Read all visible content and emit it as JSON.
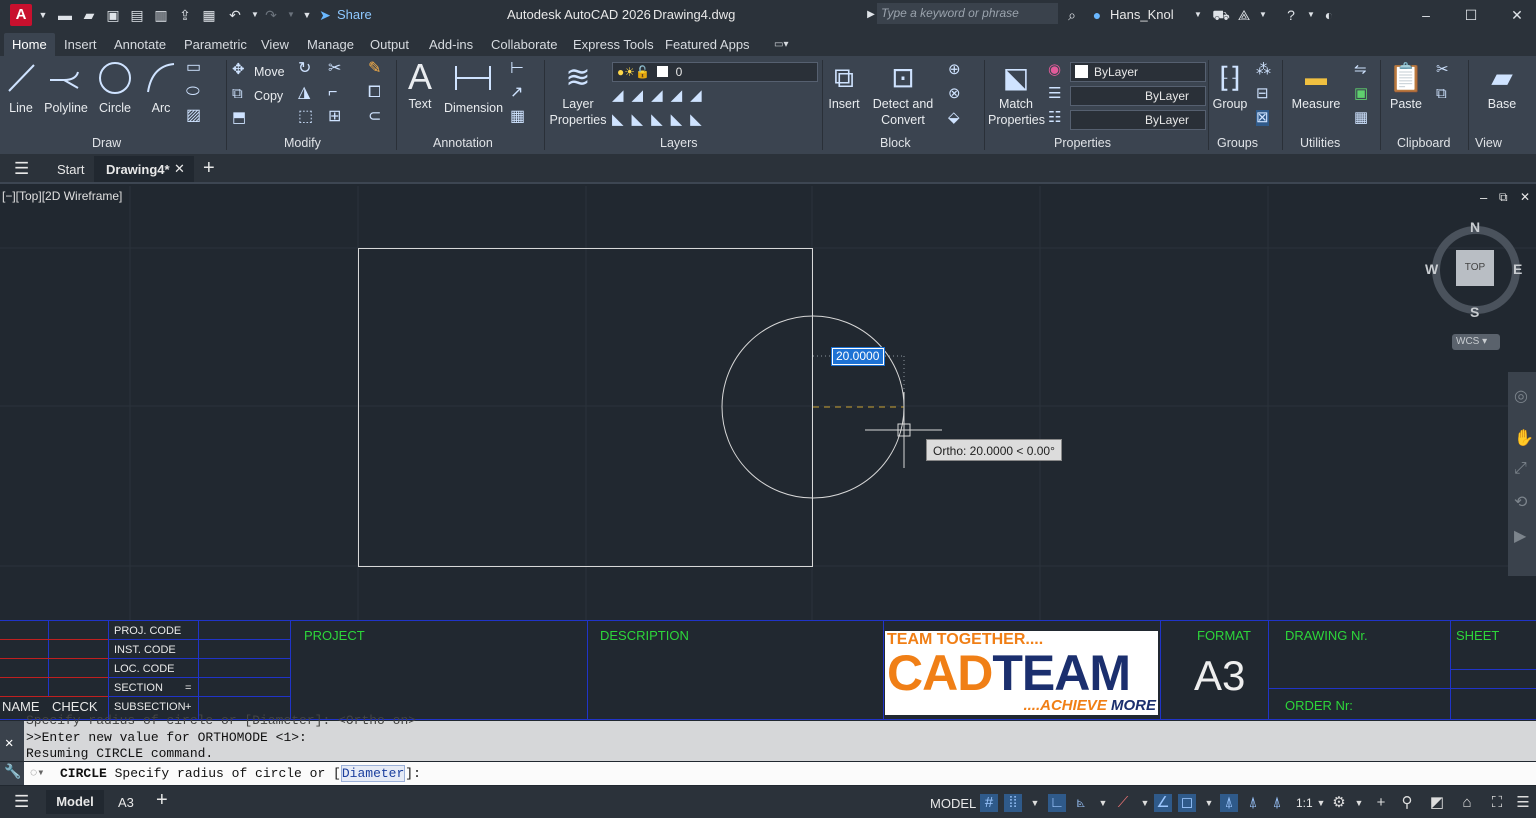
{
  "titlebar": {
    "app_logo": "A",
    "share_label": "Share",
    "app_title": "Autodesk AutoCAD 2026",
    "file_name": "Drawing4.dwg",
    "search_placeholder": "Type a keyword or phrase",
    "user_name": "Hans_Knol"
  },
  "ribbon_tabs": [
    "Home",
    "Insert",
    "Annotate",
    "Parametric",
    "View",
    "Manage",
    "Output",
    "Add-ins",
    "Collaborate",
    "Express Tools",
    "Featured Apps"
  ],
  "ribbon": {
    "draw": {
      "title": "Draw",
      "line": "Line",
      "polyline": "Polyline",
      "circle": "Circle",
      "arc": "Arc"
    },
    "modify": {
      "title": "Modify",
      "move": "Move",
      "copy": "Copy"
    },
    "annotation": {
      "title": "Annotation",
      "text": "Text",
      "dimension": "Dimension"
    },
    "layers": {
      "title": "Layers",
      "layer_properties_1": "Layer",
      "layer_properties_2": "Properties",
      "current_layer": "0"
    },
    "block": {
      "title": "Block",
      "insert": "Insert",
      "detect_1": "Detect and",
      "detect_2": "Convert"
    },
    "properties": {
      "title": "Properties",
      "match_1": "Match",
      "match_2": "Properties",
      "color": "ByLayer",
      "linetype": "ByLayer",
      "lineweight": "ByLayer"
    },
    "groups": {
      "title": "Groups",
      "group": "Group"
    },
    "utilities": {
      "title": "Utilities",
      "measure": "Measure"
    },
    "clipboard": {
      "title": "Clipboard",
      "paste": "Paste"
    },
    "view": {
      "title": "View",
      "base": "Base"
    }
  },
  "doc_tabs": {
    "start": "Start",
    "drawing": "Drawing4*"
  },
  "viewport": {
    "label": "[−][Top][2D Wireframe]",
    "dyn_input": "20.0000",
    "tooltip": "Ortho: 20.0000 < 0.00°",
    "compass": {
      "n": "N",
      "s": "S",
      "e": "E",
      "w": "W",
      "top": "TOP",
      "wcs": "WCS"
    }
  },
  "title_block": {
    "proj_code": "PROJ. CODE",
    "inst_code": "INST. CODE",
    "loc_code": "LOC. CODE",
    "section": "SECTION",
    "section_sym": "=",
    "subsection": "SUBSECTION",
    "subsection_sym": "+",
    "name": "NAME",
    "check": "CHECK",
    "project": "PROJECT",
    "description": "DESCRIPTION",
    "logo_top": "TEAM TOGETHER....",
    "logo_cad": "CAD",
    "logo_team": "TEAM",
    "logo_bottom_1": "....ACHIEVE",
    "logo_bottom_2": "MORE",
    "format": "FORMAT",
    "format_value": "A3",
    "drawing_nr": "DRAWING Nr.",
    "sheet": "SHEET",
    "order_nr": "ORDER Nr:"
  },
  "command": {
    "history_1": "Specify radius of circle or [Diameter]: <Ortho on>",
    "history_2": ">>Enter new value for ORTHOMODE <1>:",
    "history_3": "Resuming CIRCLE command.",
    "prompt_cmd": "CIRCLE",
    "prompt_text": "Specify radius of circle or [",
    "prompt_option": "Diameter",
    "prompt_end": "]:"
  },
  "status": {
    "model_tab": "Model",
    "layout_tab": "A3",
    "model_label": "MODEL",
    "scale": "1:1"
  },
  "colors": {
    "accent": "#0696d7",
    "title_block_green": "#2dd63a",
    "logo_orange": "#f07f16",
    "logo_navy": "#1b2f6e"
  }
}
